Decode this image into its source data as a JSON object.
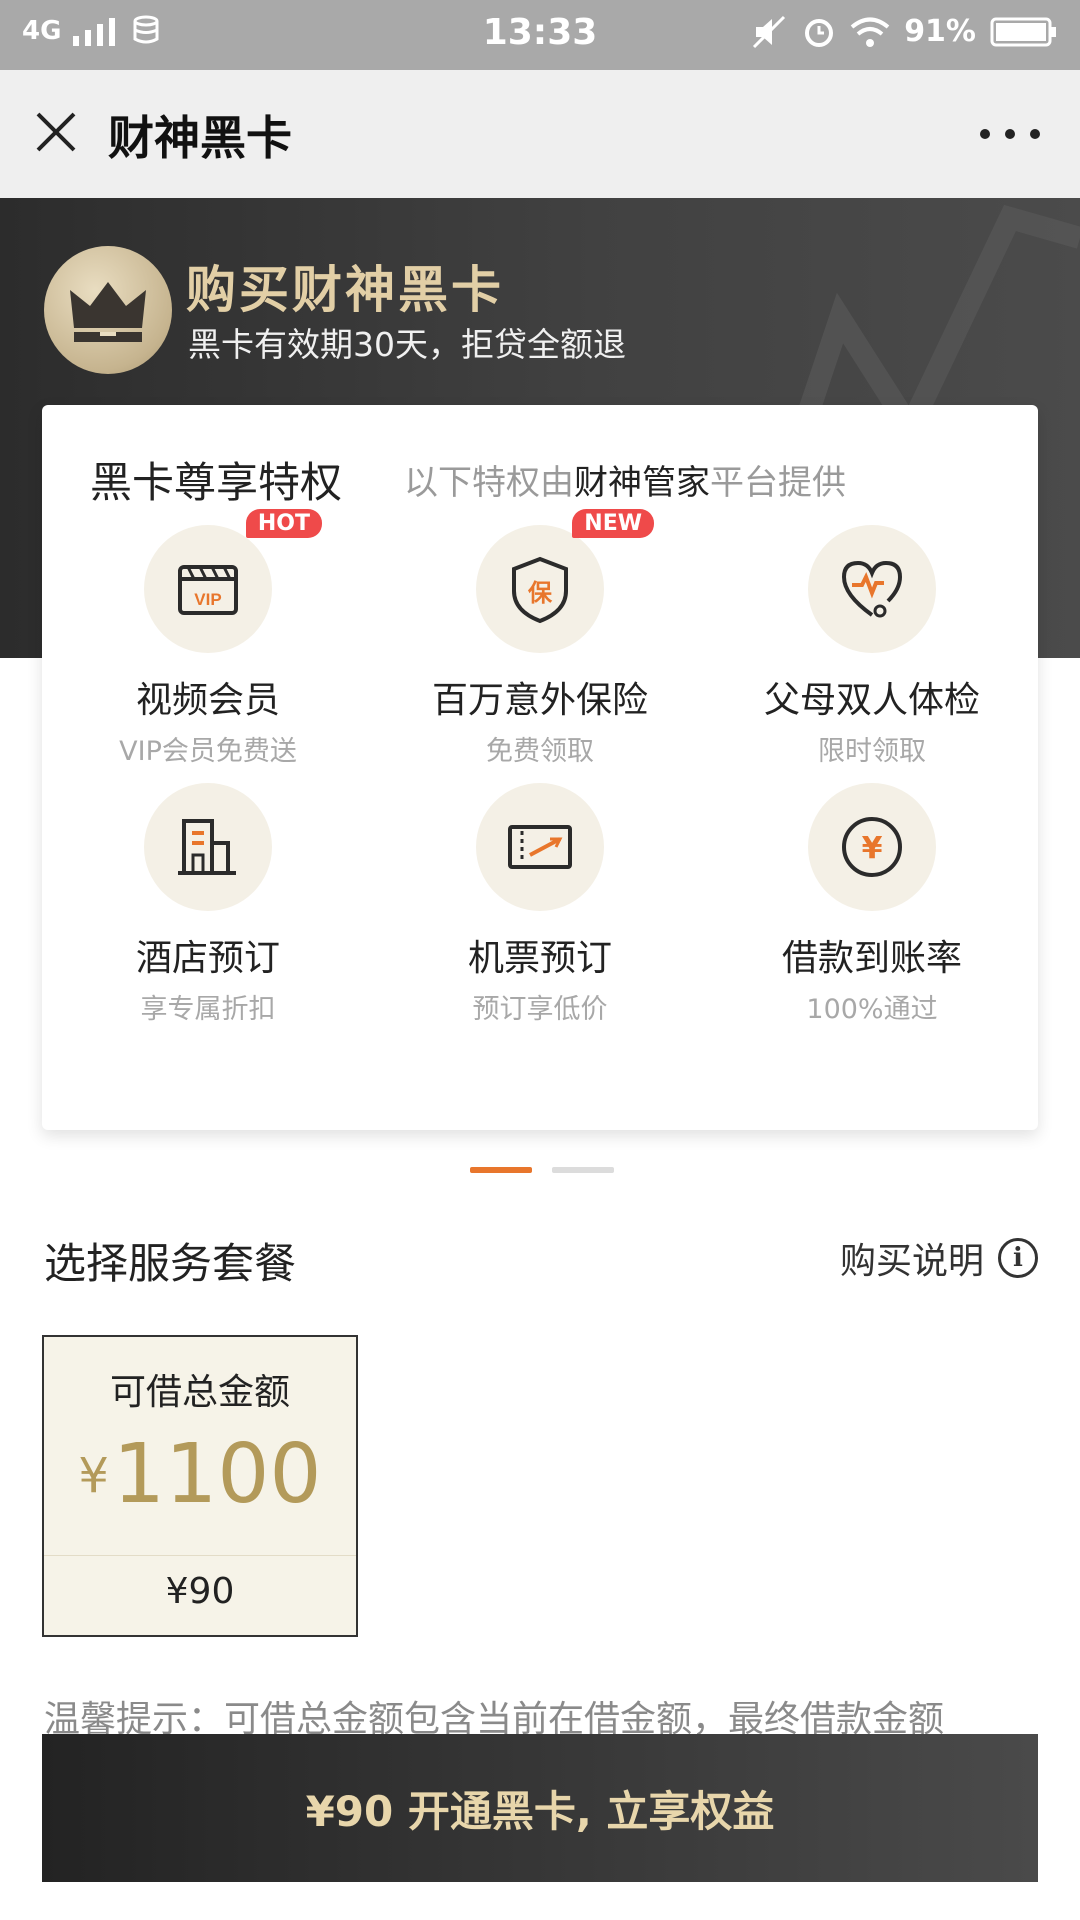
{
  "status_bar": {
    "network": "4G",
    "time": "13:33",
    "battery": "91%"
  },
  "header": {
    "title": "财神黑卡"
  },
  "banner": {
    "title": "购买财神黑卡",
    "subtitle": "黑卡有效期30天，拒贷全额退"
  },
  "privileges": {
    "title": "黑卡尊享特权",
    "provider_prefix": "以下特权由",
    "provider_name": "财神管家",
    "provider_suffix": "平台提供",
    "items": [
      {
        "name": "视频会员",
        "desc": "VIP会员免费送",
        "badge": "HOT",
        "icon": "vip-ticket-icon"
      },
      {
        "name": "百万意外保险",
        "desc": "免费领取",
        "badge": "NEW",
        "icon": "shield-insurance-icon"
      },
      {
        "name": "父母双人体检",
        "desc": "限时领取",
        "badge": "",
        "icon": "heart-stethoscope-icon"
      },
      {
        "name": "酒店预订",
        "desc": "享专属折扣",
        "badge": "",
        "icon": "hotel-building-icon"
      },
      {
        "name": "机票预订",
        "desc": "预订享低价",
        "badge": "",
        "icon": "plane-ticket-icon"
      },
      {
        "name": "借款到账率",
        "desc": "100%通过",
        "badge": "",
        "icon": "yen-coin-icon"
      }
    ],
    "pager": {
      "pages": 2,
      "active": 1
    }
  },
  "package_section": {
    "title": "选择服务套餐",
    "help_label": "购买说明"
  },
  "package": {
    "label": "可借总金额",
    "currency": "¥",
    "amount": "1100",
    "price": "¥90"
  },
  "tip": "温馨提示：可借总金额包含当前在借金额，最终借款金额",
  "cta": {
    "label": "¥90 开通黑卡, 立享权益"
  },
  "colors": {
    "gold": "#b39a5a",
    "accent_orange": "#e8762c",
    "badge_red": "#ef4a4a",
    "icon_bg": "#f4f0e6"
  }
}
